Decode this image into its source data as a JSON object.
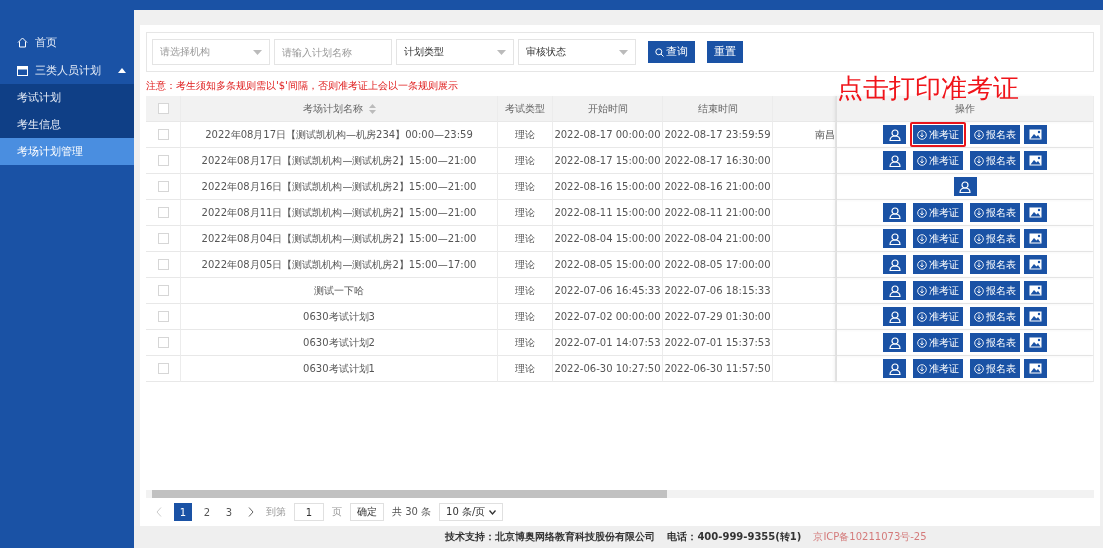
{
  "sidebar": {
    "items": [
      {
        "label": "首页",
        "kind": "home",
        "selected": false
      },
      {
        "label": "三类人员计划",
        "kind": "group",
        "expanded": true,
        "selected": false,
        "children": [
          {
            "label": "考试计划",
            "selected": false
          },
          {
            "label": "考生信息",
            "selected": false
          },
          {
            "label": "考场计划管理",
            "selected": true
          }
        ]
      }
    ]
  },
  "filters": [
    {
      "kind": "select",
      "placeholder": "请选择机构"
    },
    {
      "kind": "input",
      "placeholder": "请输入计划名称"
    },
    {
      "kind": "select",
      "value": "计划类型"
    },
    {
      "kind": "select",
      "value": "审核状态"
    }
  ],
  "filter_buttons": [
    {
      "label": "查询",
      "kind": "search"
    },
    {
      "label": "重置",
      "kind": "plain"
    }
  ],
  "notice": "注意：考生须知多条规则需以'$'间隔，否则准考证上会以一条规则展示",
  "annotation": "点击打印准考证",
  "table": {
    "header_checked": false,
    "columns": [
      {
        "label": "考场计划名称",
        "kind": "sortable"
      },
      {
        "label": "考试类型",
        "kind": "plain"
      },
      {
        "label": "开始时间",
        "kind": "plain"
      },
      {
        "label": "结束时间",
        "kind": "plain"
      },
      {
        "kind": "plain"
      },
      {
        "label": "操作",
        "kind": "plain"
      }
    ],
    "rows": [
      {
        "checked": false,
        "name": "2022年08月17日【测试凯机构—机房234】00:00—23:59",
        "type": "理论",
        "start": "2022-08-17 00:00:00",
        "end": "2022-08-17 23:59:59",
        "column_5": "南昌",
        "kind": "full",
        "admit": "准考证",
        "form": "报名表",
        "highlighted": true
      },
      {
        "checked": false,
        "name": "2022年08月17日【测试凯机构—测试机房2】15:00—21:00",
        "type": "理论",
        "start": "2022-08-17 15:00:00",
        "end": "2022-08-17 16:30:00",
        "kind": "full",
        "admit": "准考证",
        "form": "报名表",
        "highlighted": false
      },
      {
        "checked": false,
        "name": "2022年08月16日【测试凯机构—测试机房2】15:00—21:00",
        "type": "理论",
        "start": "2022-08-16 15:00:00",
        "end": "2022-08-16 21:00:00",
        "kind": "single"
      },
      {
        "checked": false,
        "name": "2022年08月11日【测试凯机构—测试机房2】15:00—21:00",
        "type": "理论",
        "start": "2022-08-11 15:00:00",
        "end": "2022-08-11 21:00:00",
        "kind": "full",
        "admit": "准考证",
        "form": "报名表",
        "highlighted": false
      },
      {
        "checked": false,
        "name": "2022年08月04日【测试凯机构—测试机房2】15:00—21:00",
        "type": "理论",
        "start": "2022-08-04 15:00:00",
        "end": "2022-08-04 21:00:00",
        "kind": "full",
        "admit": "准考证",
        "form": "报名表",
        "highlighted": false
      },
      {
        "checked": false,
        "name": "2022年08月05日【测试凯机构—测试机房2】15:00—17:00",
        "type": "理论",
        "start": "2022-08-05 15:00:00",
        "end": "2022-08-05 17:00:00",
        "kind": "full",
        "admit": "准考证",
        "form": "报名表",
        "highlighted": false
      },
      {
        "checked": false,
        "name": "测试一下哈",
        "type": "理论",
        "start": "2022-07-06 16:45:33",
        "end": "2022-07-06 18:15:33",
        "kind": "full",
        "admit": "准考证",
        "form": "报名表",
        "highlighted": false
      },
      {
        "checked": false,
        "name": "0630考试计划3",
        "type": "理论",
        "start": "2022-07-02 00:00:00",
        "end": "2022-07-29 01:30:00",
        "kind": "full",
        "admit": "准考证",
        "form": "报名表",
        "highlighted": false
      },
      {
        "checked": false,
        "name": "0630考试计划2",
        "type": "理论",
        "start": "2022-07-01 14:07:53",
        "end": "2022-07-01 15:37:53",
        "kind": "full",
        "admit": "准考证",
        "form": "报名表",
        "highlighted": false
      },
      {
        "checked": false,
        "name": "0630考试计划1",
        "type": "理论",
        "start": "2022-06-30 10:27:50",
        "end": "2022-06-30 11:57:50",
        "kind": "full",
        "admit": "准考证",
        "form": "报名表",
        "highlighted": false
      }
    ]
  },
  "pagination": {
    "pages": [
      {
        "label": "1",
        "selected": true
      },
      {
        "label": "2",
        "selected": false
      },
      {
        "label": "3",
        "selected": false
      }
    ],
    "goto_label": "到第",
    "goto_value": "1",
    "page_unit": "页",
    "confirm": "确定",
    "total": "共 30 条",
    "page_size": "10 条/页"
  },
  "footer": {
    "support": "技术支持：北京博奥网络教育科技股份有限公司",
    "phone": "电话：400-999-9355(转1)",
    "icp": "京ICP备10211073号-25"
  }
}
